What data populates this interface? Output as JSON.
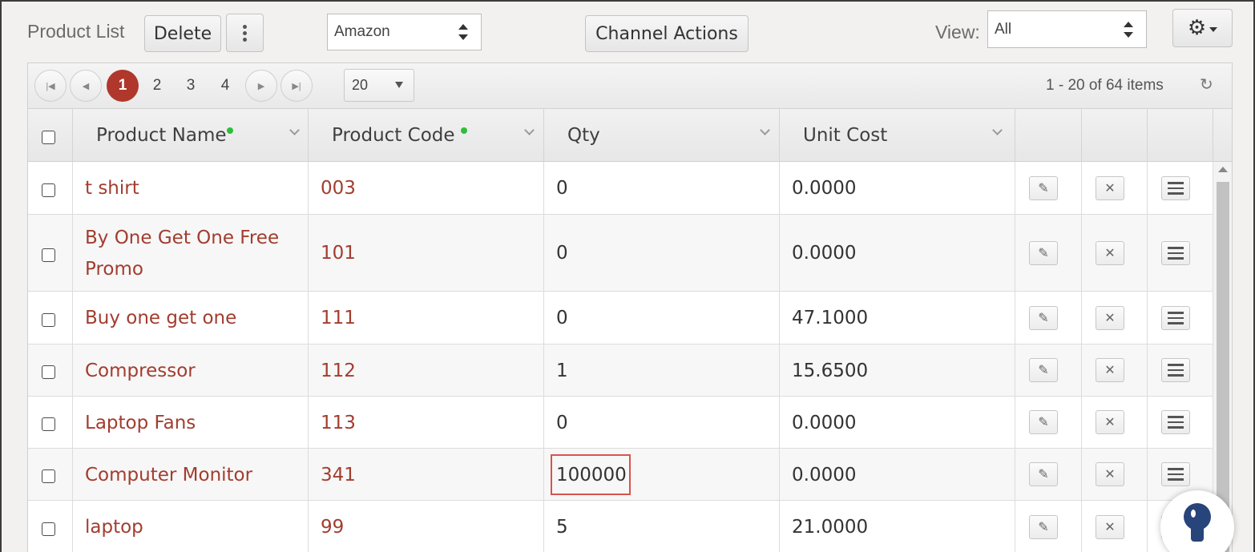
{
  "toolbar": {
    "title": "Product List",
    "delete_label": "Delete",
    "channel_value": "Amazon",
    "channel_actions_label": "Channel Actions",
    "view_label": "View:",
    "view_value": "All"
  },
  "pager": {
    "pages": [
      "1",
      "2",
      "3",
      "4"
    ],
    "page_size": "20",
    "items_info": "1 - 20 of 64 items"
  },
  "columns": [
    "Product Name",
    "Product Code",
    "Qty",
    "Unit Cost"
  ],
  "rows": [
    {
      "name": "t shirt",
      "code": "003",
      "qty": "0",
      "cost": "0.0000"
    },
    {
      "name": "By One Get One Free Promo",
      "name_line1": "By One Get One Free",
      "name_line2": "Promo",
      "code": "101",
      "qty": "0",
      "cost": "0.0000"
    },
    {
      "name": "Buy one get one",
      "code": "111",
      "qty": "0",
      "cost": "47.1000"
    },
    {
      "name": "Compressor",
      "code": "112",
      "qty": "1",
      "cost": "15.6500"
    },
    {
      "name": "Laptop Fans",
      "code": "113",
      "qty": "0",
      "cost": "0.0000"
    },
    {
      "name": "Computer Monitor",
      "code": "341",
      "qty": "100000",
      "cost": "0.0000"
    },
    {
      "name": "laptop",
      "code": "99",
      "qty": "5",
      "cost": "21.0000"
    }
  ],
  "colors": {
    "accent": "#b0372b",
    "link": "#a23d2f",
    "highlight": "#d9534f",
    "required_dot": "#2ebd3c"
  }
}
